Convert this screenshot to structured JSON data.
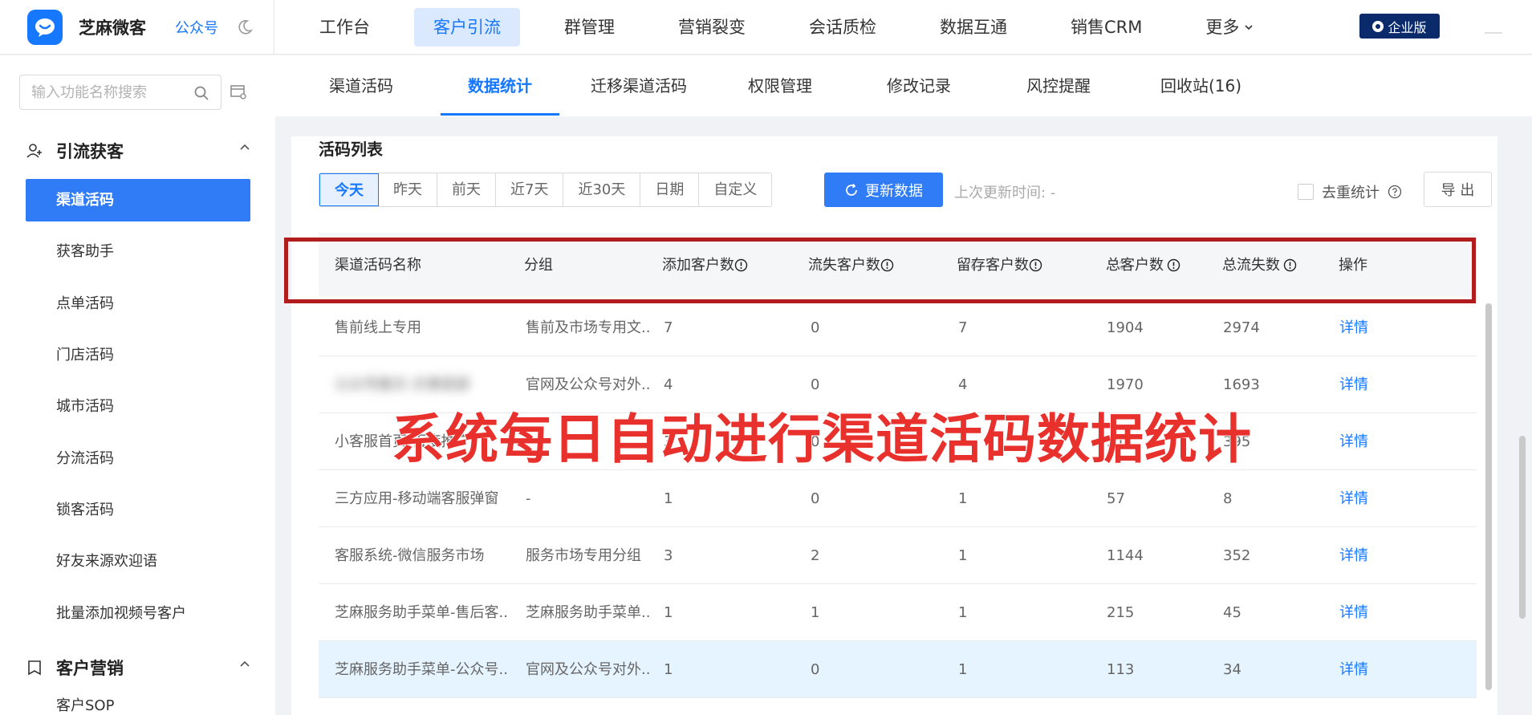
{
  "app": {
    "name": "芝麻微客",
    "link": "公众号",
    "enterprise_badge": "企业版"
  },
  "topnav": [
    {
      "label": "工作台"
    },
    {
      "label": "客户引流"
    },
    {
      "label": "群管理"
    },
    {
      "label": "营销裂变"
    },
    {
      "label": "会话质检"
    },
    {
      "label": "数据互通"
    },
    {
      "label": "销售CRM"
    },
    {
      "label": "更多"
    }
  ],
  "sidebar": {
    "search_placeholder": "输入功能名称搜索",
    "group1": "引流获客",
    "items": [
      {
        "label": "渠道活码"
      },
      {
        "label": "获客助手"
      },
      {
        "label": "点单活码"
      },
      {
        "label": "门店活码"
      },
      {
        "label": "城市活码"
      },
      {
        "label": "分流活码"
      },
      {
        "label": "锁客活码"
      },
      {
        "label": "好友来源欢迎语"
      },
      {
        "label": "批量添加视频号客户"
      }
    ],
    "group2": "客户营销",
    "partial_item": "客户SOP"
  },
  "subtabs": [
    {
      "label": "渠道活码"
    },
    {
      "label": "数据统计"
    },
    {
      "label": "迁移渠道活码"
    },
    {
      "label": "权限管理"
    },
    {
      "label": "修改记录"
    },
    {
      "label": "风控提醒"
    },
    {
      "label": "回收站(16)"
    }
  ],
  "main": {
    "section_title": "活码列表",
    "date_filters": [
      {
        "label": "今天"
      },
      {
        "label": "昨天"
      },
      {
        "label": "前天"
      },
      {
        "label": "近7天"
      },
      {
        "label": "近30天"
      },
      {
        "label": "日期"
      },
      {
        "label": "自定义"
      }
    ],
    "refresh_label": "更新数据",
    "last_update": "上次更新时间: -",
    "dedupe_label": "去重统计",
    "export_label": "导 出",
    "columns": {
      "name": "渠道活码名称",
      "group": "分组",
      "added": "添加客户数",
      "lost": "流失客户数",
      "retained": "留存客户数",
      "total": "总客户数",
      "total_lost": "总流失数",
      "action": "操作"
    },
    "rows": [
      {
        "name": "售前线上专用",
        "group": "售前及市场专用文..",
        "added": "7",
        "lost": "0",
        "retained": "7",
        "total": "1904",
        "total_lost": "2974",
        "action": "详情"
      },
      {
        "name": "公众号推文-文章底部",
        "group": "官网及公众号对外..",
        "added": "4",
        "lost": "0",
        "retained": "4",
        "total": "1970",
        "total_lost": "1693",
        "action": "详情"
      },
      {
        "name": "小客服首页-百度推广",
        "group": "",
        "added": "3",
        "lost": "0",
        "retained": "3",
        "total": "311",
        "total_lost": "395",
        "action": "详情"
      },
      {
        "name": "三方应用-移动端客服弹窗",
        "group": "-",
        "added": "1",
        "lost": "0",
        "retained": "1",
        "total": "57",
        "total_lost": "8",
        "action": "详情"
      },
      {
        "name": "客服系统-微信服务市场",
        "group": "服务市场专用分组",
        "added": "3",
        "lost": "2",
        "retained": "1",
        "total": "1144",
        "total_lost": "352",
        "action": "详情"
      },
      {
        "name": "芝麻服务助手菜单-售后客..",
        "group": "芝麻服务助手菜单..",
        "added": "1",
        "lost": "1",
        "retained": "1",
        "total": "215",
        "total_lost": "45",
        "action": "详情"
      },
      {
        "name": "芝麻服务助手菜单-公众号..",
        "group": "官网及公众号对外..",
        "added": "1",
        "lost": "0",
        "retained": "1",
        "total": "113",
        "total_lost": "34",
        "action": "详情"
      }
    ]
  },
  "annotation": {
    "overlay_text": "系统每日自动进行渠道活码数据统计",
    "box_color": "#b31c1c",
    "text_color": "#e8312c"
  },
  "colors": {
    "accent": "#1677ff",
    "active_sidebar": "#2f7cf6",
    "enterprise": "#0a2a6b",
    "highlight_row": "#e6f4ff"
  }
}
